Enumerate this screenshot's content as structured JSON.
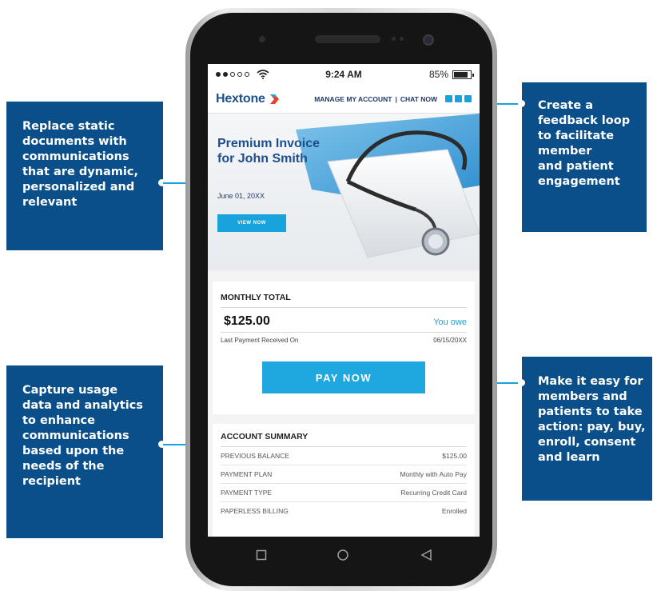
{
  "callouts": {
    "top_left": "Replace static\ndocuments with\ncommunications\nthat are dynamic,\npersonalized and\nrelevant",
    "top_right": "Create a\nfeedback loop\nto facilitate\nmember\nand patient\nengagement",
    "bottom_left": "Capture usage\ndata and analytics\nto enhance\ncommunications\nbased upon the\nneeds of the\nrecipient",
    "bottom_right": "Make it easy for\nmembers and\npatients to take\naction: pay, buy,\nenroll, consent\nand learn"
  },
  "statusbar": {
    "carrier": "●●○○○",
    "time": "9:24 AM",
    "battery": "85%",
    "battery_level": 0.85
  },
  "header": {
    "logo": "Hextone",
    "manage_account": "MANAGE MY ACCOUNT",
    "separator": "|",
    "chat_now": "CHAT NOW"
  },
  "hero": {
    "title": "Premium Invoice for John Smith",
    "date": "June 01, 20XX",
    "button": "VIEW NOW"
  },
  "monthly": {
    "heading": "MONTHLY TOTAL",
    "amount": "$125.00",
    "amount_label": "You owe",
    "last_payment_label": "Last Payment Received On",
    "last_payment_date": "06/15/20XX",
    "pay_button": "PAY NOW"
  },
  "summary": {
    "heading": "ACCOUNT SUMMARY",
    "rows": [
      {
        "label": "PREVIOUS BALANCE",
        "value": "$125.00"
      },
      {
        "label": "PAYMENT PLAN",
        "value": "Monthly with Auto Pay"
      },
      {
        "label": "PAYMENT TYPE",
        "value": "Recurring Credit Card"
      },
      {
        "label": "PAPERLESS BILLING",
        "value": "Enrolled"
      }
    ]
  },
  "colors": {
    "callout_bg": "#0b4f8a",
    "accent": "#19a3dc",
    "logo_blue": "#1e4e8c",
    "logo_red": "#e8402c"
  },
  "icons": {
    "wifi": "wifi-icon",
    "battery": "battery-icon",
    "home": "home-circle-icon",
    "back": "back-triangle-icon",
    "recents": "recents-square-icon"
  }
}
